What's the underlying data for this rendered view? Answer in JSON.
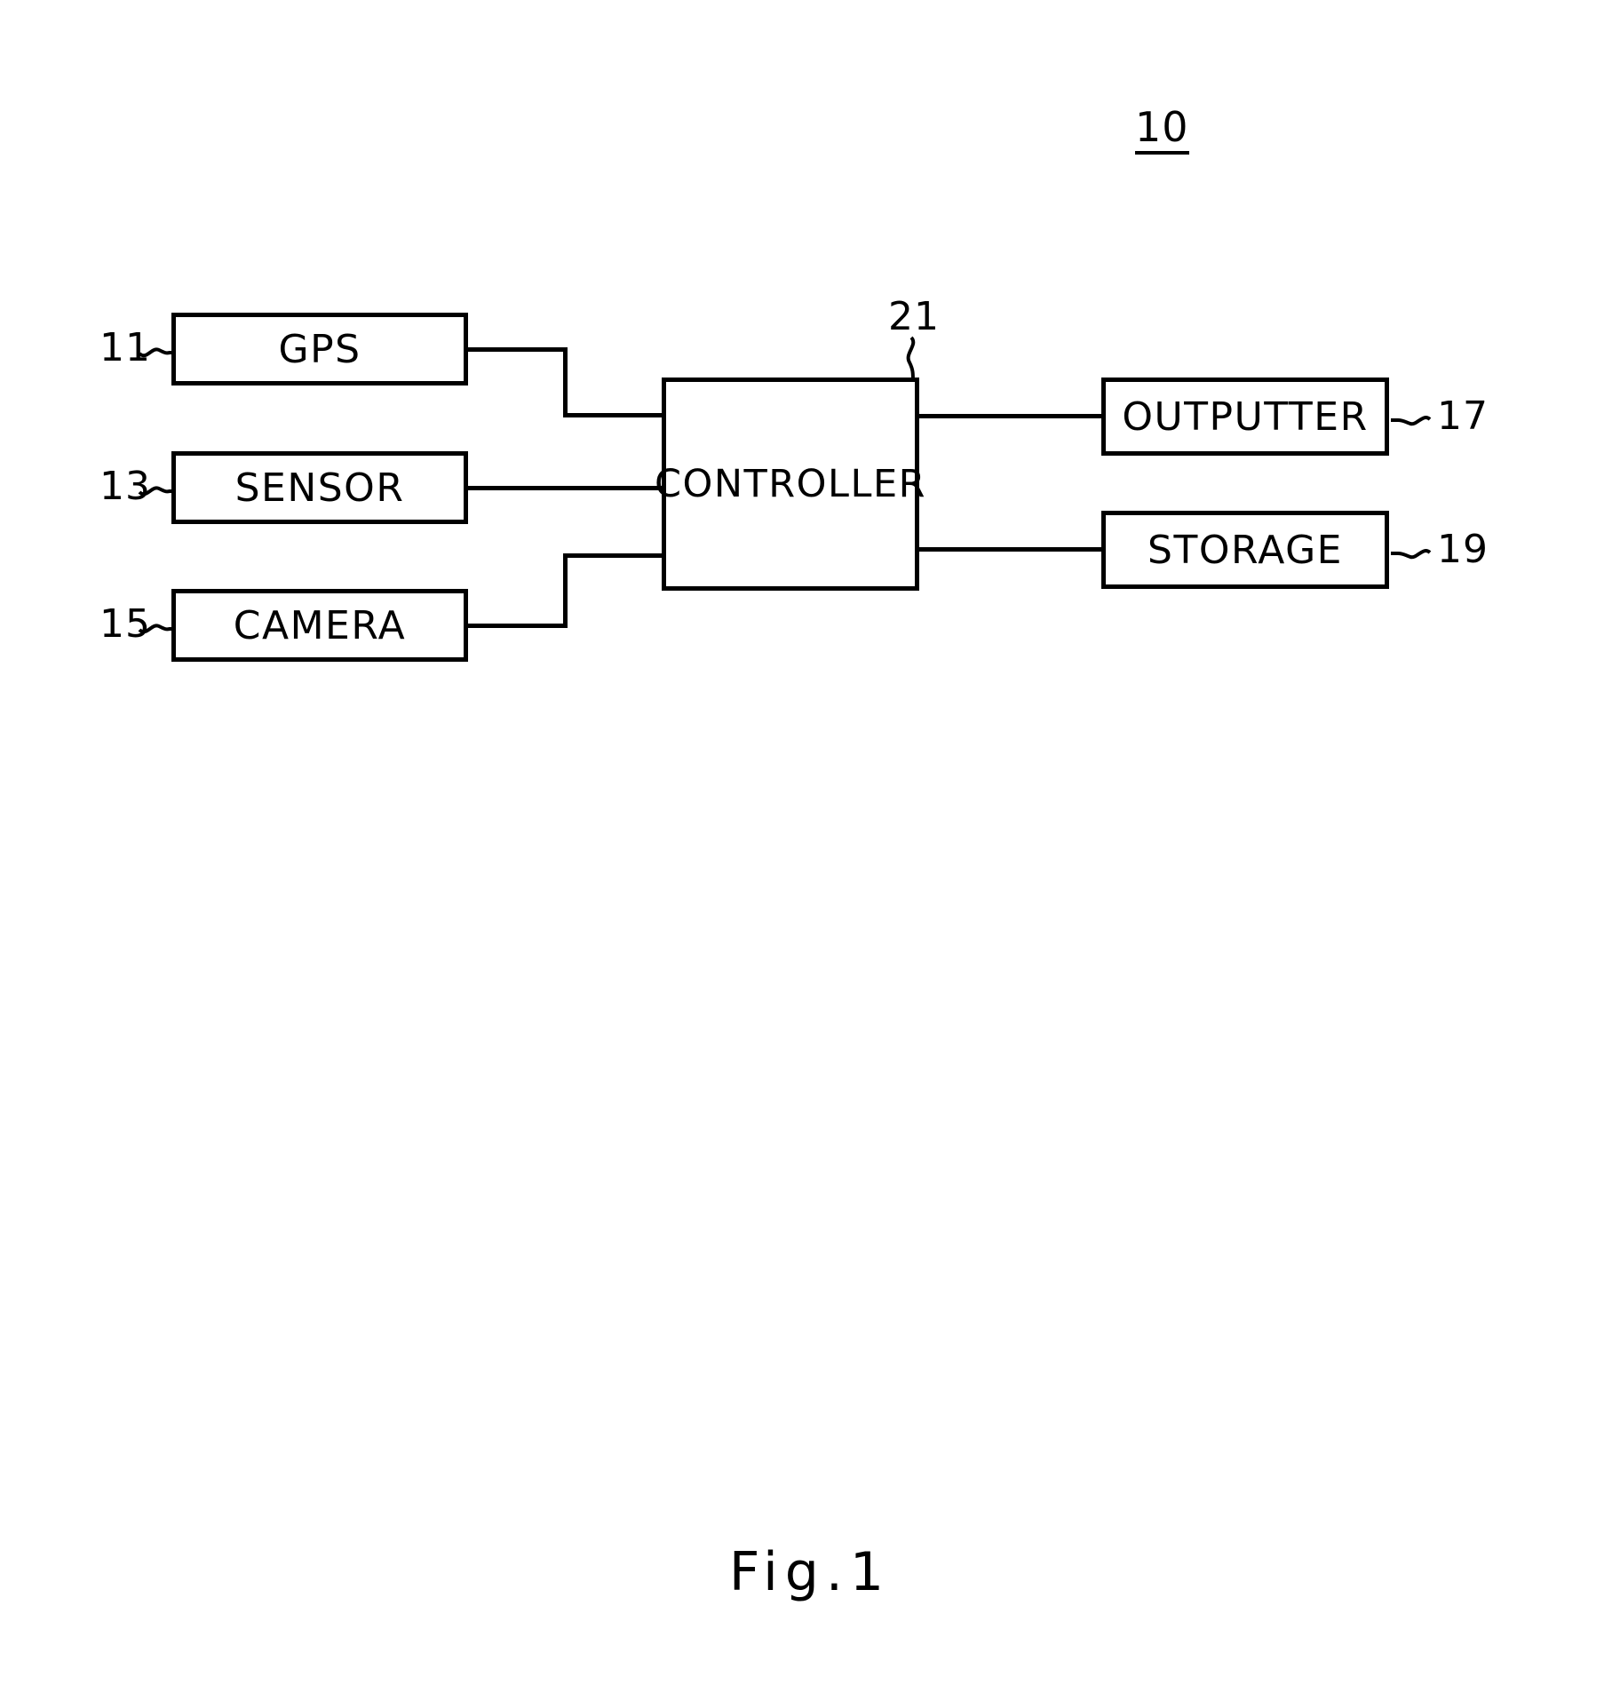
{
  "figure": {
    "caption": "Fig.1",
    "system_ref": "10"
  },
  "blocks": [
    {
      "id": "gps",
      "label": "GPS",
      "ref": "11"
    },
    {
      "id": "sensor",
      "label": "SENSOR",
      "ref": "13"
    },
    {
      "id": "camera",
      "label": "CAMERA",
      "ref": "15"
    },
    {
      "id": "controller",
      "label": "CONTROLLER",
      "ref": "21"
    },
    {
      "id": "outputter",
      "label": "OUTPUTTER",
      "ref": "17"
    },
    {
      "id": "storage",
      "label": "STORAGE",
      "ref": "19"
    }
  ],
  "connections": [
    {
      "from": "gps",
      "to": "controller",
      "style": "stepped-down"
    },
    {
      "from": "sensor",
      "to": "controller",
      "style": "straight"
    },
    {
      "from": "camera",
      "to": "controller",
      "style": "stepped-up"
    },
    {
      "from": "controller",
      "to": "outputter",
      "style": "straight"
    },
    {
      "from": "controller",
      "to": "storage",
      "style": "straight"
    }
  ],
  "colors": {
    "ink": "#000000",
    "paper": "#ffffff"
  }
}
